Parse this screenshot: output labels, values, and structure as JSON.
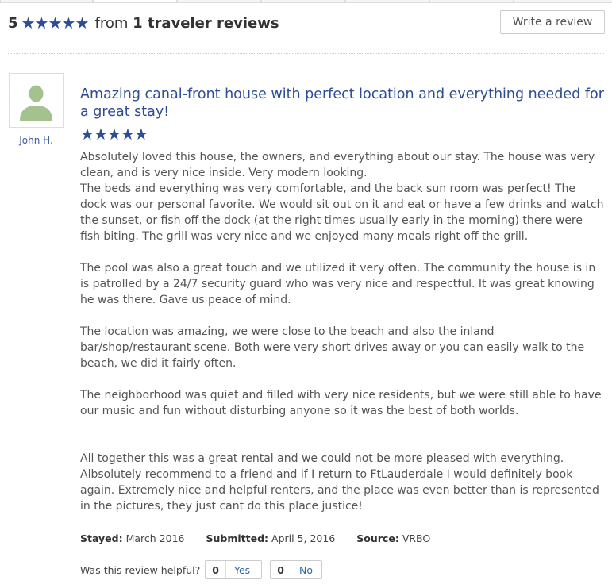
{
  "summary": {
    "rating_number": "5",
    "star_count": 5,
    "from_text": "from",
    "reviews_count_text": "1 traveler reviews",
    "write_review_label": "Write a review"
  },
  "review": {
    "author": "John H.",
    "title": "Amazing canal-front house with perfect location and everything needed for a great stay!",
    "star_count": 5,
    "body": "Absolutely loved this house, the owners, and everything about our stay. The house was very clean, and is very nice inside. Very modern looking.\nThe beds and everything was very comfortable, and the back sun room was perfect! The dock was our personal favorite. We would sit out on it and eat or have a few drinks and watch the sunset, or fish off the dock (at the right times usually early in the morning) there were fish biting. The grill was very nice and we enjoyed many meals right off the grill.\n\nThe pool was also a great touch and we utilized it very often. The community the house is in is patrolled by a 24/7 security guard who was very nice and respectful. It was great knowing he was there. Gave us peace of mind.\n\nThe location was amazing, we were close to the beach and also the inland bar/shop/restaurant scene. Both were very short drives away or you can easily walk to the beach, we did it fairly often.\n\nThe neighborhood was quiet and filled with very nice residents, but we were still able to have our music and fun without disturbing anyone so it was the best of both worlds.\n\n\nAll together this was a great rental and we could not be more pleased with everything. Albsolutely recommend to a friend and if I return to FtLauderdale I would definitely book again. Extremely nice and helpful renters, and the place was even better than is represented in the pictures, they just cant do this place justice!",
    "stayed_label": "Stayed:",
    "stayed_value": "March 2016",
    "submitted_label": "Submitted:",
    "submitted_value": "April 5, 2016",
    "source_label": "Source:",
    "source_value": "VRBO"
  },
  "helpful": {
    "question": "Was this review helpful?",
    "yes_count": "0",
    "yes_label": "Yes",
    "no_count": "0",
    "no_label": "No"
  },
  "colors": {
    "accent": "#2d4c96",
    "avatar": "#a3c28e"
  },
  "icons": {
    "star": "star-icon",
    "avatar": "user-silhouette-icon"
  }
}
